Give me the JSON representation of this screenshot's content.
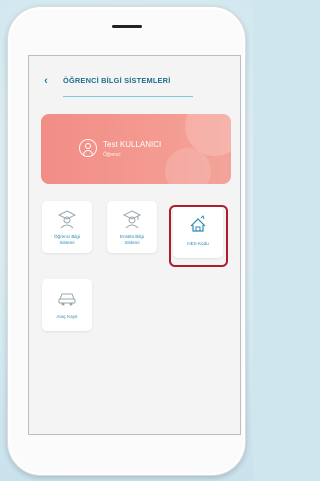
{
  "header": {
    "back_label": "‹",
    "title": "ÖĞRENCİ BİLGİ SİSTEMLERİ"
  },
  "profile": {
    "name": "Test KULLANICI",
    "role": "Öğrenci"
  },
  "tiles": [
    {
      "label_line1": "Öğrenci Bilgi",
      "label_line2": "Sistemi",
      "icon": "student-icon"
    },
    {
      "label_line1": "Enstitü Bilgi",
      "label_line2": "Sistemi",
      "icon": "graduate-icon"
    },
    {
      "label_line1": "HES Kodu",
      "label_line2": "",
      "icon": "hes-code-icon",
      "highlighted": true
    },
    {
      "label_line1": "Araç Kayıt",
      "label_line2": "",
      "icon": "car-icon"
    }
  ],
  "colors": {
    "accent": "#1f6f8c",
    "profile_card": "#f28d86",
    "highlight": "#b01c2e"
  }
}
